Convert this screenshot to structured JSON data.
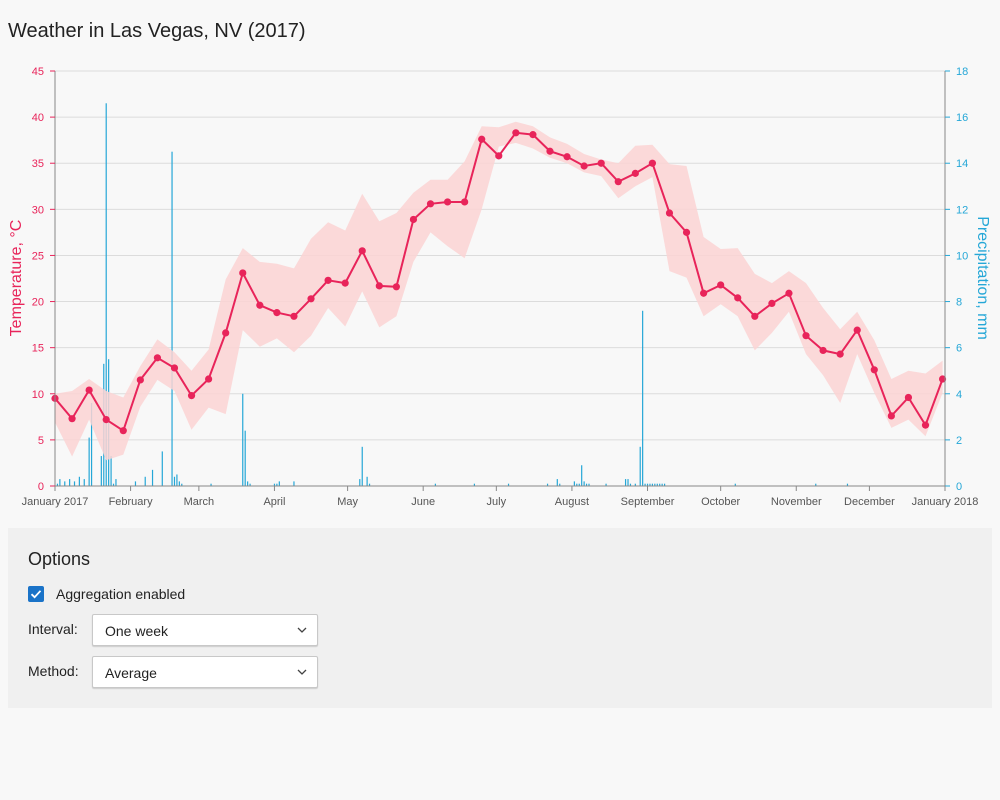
{
  "title": "Weather in Las Vegas, NV (2017)",
  "colors": {
    "temperature": "#e8245a",
    "temperature_band": "#fcd3d3",
    "precipitation": "#25a7d7",
    "accent": "#1a73c8"
  },
  "chart_data": {
    "type": "line",
    "title": "Weather in Las Vegas, NV (2017)",
    "x_labels": [
      "January 2017",
      "February",
      "March",
      "April",
      "May",
      "June",
      "July",
      "August",
      "September",
      "October",
      "November",
      "December",
      "January 2018"
    ],
    "left_axis": {
      "label": "Temperature, °C",
      "range": [
        0,
        45
      ],
      "ticks": [
        0,
        5,
        10,
        15,
        20,
        25,
        30,
        35,
        40,
        45
      ]
    },
    "right_axis": {
      "label": "Precipitation, mm",
      "range": [
        0,
        18
      ],
      "ticks": [
        0,
        2,
        4,
        6,
        8,
        10,
        12,
        14,
        16,
        18
      ]
    },
    "grid": true,
    "series": [
      {
        "name": "Temperature, °C",
        "kind": "line-with-range",
        "x": [
          "2017-01-01",
          "2017-01-08",
          "2017-01-15",
          "2017-01-22",
          "2017-01-29",
          "2017-02-05",
          "2017-02-12",
          "2017-02-19",
          "2017-02-26",
          "2017-03-05",
          "2017-03-12",
          "2017-03-19",
          "2017-03-26",
          "2017-04-02",
          "2017-04-09",
          "2017-04-16",
          "2017-04-23",
          "2017-04-30",
          "2017-05-07",
          "2017-05-14",
          "2017-05-21",
          "2017-05-28",
          "2017-06-04",
          "2017-06-11",
          "2017-06-18",
          "2017-06-25",
          "2017-07-02",
          "2017-07-09",
          "2017-07-16",
          "2017-07-23",
          "2017-07-30",
          "2017-08-06",
          "2017-08-13",
          "2017-08-20",
          "2017-08-27",
          "2017-09-03",
          "2017-09-10",
          "2017-09-17",
          "2017-09-24",
          "2017-10-01",
          "2017-10-08",
          "2017-10-15",
          "2017-10-22",
          "2017-10-29",
          "2017-11-05",
          "2017-11-12",
          "2017-11-19",
          "2017-11-26",
          "2017-12-03",
          "2017-12-10",
          "2017-12-17",
          "2017-12-24",
          "2017-12-31"
        ],
        "values": [
          9.5,
          7.3,
          10.4,
          7.2,
          6.0,
          11.5,
          13.9,
          12.8,
          9.8,
          11.6,
          16.6,
          23.1,
          19.6,
          18.8,
          18.4,
          20.3,
          22.3,
          22.0,
          25.5,
          21.7,
          21.6,
          28.9,
          30.6,
          30.8,
          30.8,
          37.6,
          35.8,
          38.3,
          38.1,
          36.3,
          35.7,
          34.7,
          35.0,
          33.0,
          33.9,
          35.0,
          29.6,
          27.5,
          20.9,
          21.8,
          20.4,
          18.4,
          19.8,
          20.9,
          16.3,
          14.7,
          14.3,
          16.9,
          12.6,
          7.6,
          9.6,
          6.6,
          11.6
        ],
        "min": [
          6.9,
          3.2,
          7.2,
          2.8,
          3.4,
          8.6,
          11.5,
          10.3,
          6.1,
          8.5,
          7.8,
          16.9,
          15.1,
          16.0,
          14.5,
          16.3,
          19.3,
          17.3,
          21.1,
          17.2,
          18.4,
          24.3,
          27.5,
          26.0,
          24.7,
          30.0,
          36.8,
          37.2,
          36.6,
          35.6,
          35.0,
          34.0,
          33.6,
          31.2,
          32.5,
          33.5,
          23.3,
          22.6,
          18.4,
          19.7,
          18.4,
          14.7,
          16.6,
          18.9,
          14.3,
          12.0,
          9.0,
          14.3,
          10.1,
          6.3,
          7.2,
          5.4,
          10.1
        ],
        "max": [
          10.0,
          10.3,
          11.6,
          10.3,
          9.6,
          13.0,
          15.9,
          14.5,
          12.5,
          14.8,
          22.4,
          25.8,
          24.3,
          24.1,
          23.6,
          26.8,
          28.6,
          27.7,
          31.7,
          28.7,
          29.6,
          31.8,
          33.2,
          33.2,
          35.2,
          39.0,
          38.9,
          39.5,
          39.0,
          37.8,
          37.1,
          36.0,
          35.4,
          35.0,
          36.9,
          37.0,
          34.9,
          34.7,
          27.0,
          25.7,
          25.8,
          23.0,
          22.0,
          23.3,
          22.0,
          19.3,
          17.0,
          18.9,
          15.8,
          11.6,
          12.5,
          12.2,
          13.6
        ]
      },
      {
        "name": "Precipitation, mm",
        "kind": "bar",
        "x": [
          "2017-01-02",
          "2017-01-03",
          "2017-01-05",
          "2017-01-07",
          "2017-01-09",
          "2017-01-11",
          "2017-01-13",
          "2017-01-15",
          "2017-01-16",
          "2017-01-20",
          "2017-01-21",
          "2017-01-22",
          "2017-01-23",
          "2017-01-24",
          "2017-01-25",
          "2017-01-26",
          "2017-02-03",
          "2017-02-07",
          "2017-02-10",
          "2017-02-14",
          "2017-02-18",
          "2017-02-19",
          "2017-02-20",
          "2017-02-21",
          "2017-02-22",
          "2017-03-06",
          "2017-03-19",
          "2017-03-20",
          "2017-03-21",
          "2017-03-22",
          "2017-04-01",
          "2017-04-02",
          "2017-04-03",
          "2017-04-09",
          "2017-05-06",
          "2017-05-07",
          "2017-05-09",
          "2017-05-10",
          "2017-06-06",
          "2017-06-22",
          "2017-07-06",
          "2017-07-22",
          "2017-07-26",
          "2017-07-27",
          "2017-08-02",
          "2017-08-03",
          "2017-08-04",
          "2017-08-05",
          "2017-08-06",
          "2017-08-07",
          "2017-08-08",
          "2017-08-15",
          "2017-08-23",
          "2017-08-24",
          "2017-08-25",
          "2017-08-27",
          "2017-08-29",
          "2017-08-30",
          "2017-08-31",
          "2017-09-01",
          "2017-09-02",
          "2017-09-03",
          "2017-09-04",
          "2017-09-05",
          "2017-09-06",
          "2017-09-07",
          "2017-09-08",
          "2017-10-07",
          "2017-11-09",
          "2017-11-22"
        ],
        "values": [
          0.1,
          0.3,
          0.2,
          0.3,
          0.2,
          0.4,
          0.3,
          2.1,
          3.6,
          1.3,
          5.3,
          16.6,
          5.5,
          1.3,
          0.1,
          0.3,
          0.2,
          0.4,
          0.7,
          1.5,
          14.5,
          0.4,
          0.5,
          0.2,
          0.1,
          0.1,
          4.0,
          2.4,
          0.2,
          0.1,
          0.1,
          0.1,
          0.2,
          0.2,
          0.3,
          1.7,
          0.4,
          0.1,
          0.1,
          0.1,
          0.1,
          0.1,
          0.3,
          0.1,
          0.2,
          0.1,
          0.1,
          0.9,
          0.2,
          0.1,
          0.1,
          0.1,
          0.3,
          0.3,
          0.1,
          0.1,
          1.7,
          7.6,
          0.1,
          0.1,
          0.1,
          0.1,
          0.1,
          0.1,
          0.1,
          0.1,
          0.1,
          0.1,
          0.1,
          0.1
        ]
      }
    ]
  },
  "options": {
    "title": "Options",
    "aggregation": {
      "label": "Aggregation enabled",
      "checked": true
    },
    "interval": {
      "label": "Interval:",
      "value": "One week"
    },
    "method": {
      "label": "Method:",
      "value": "Average"
    }
  }
}
